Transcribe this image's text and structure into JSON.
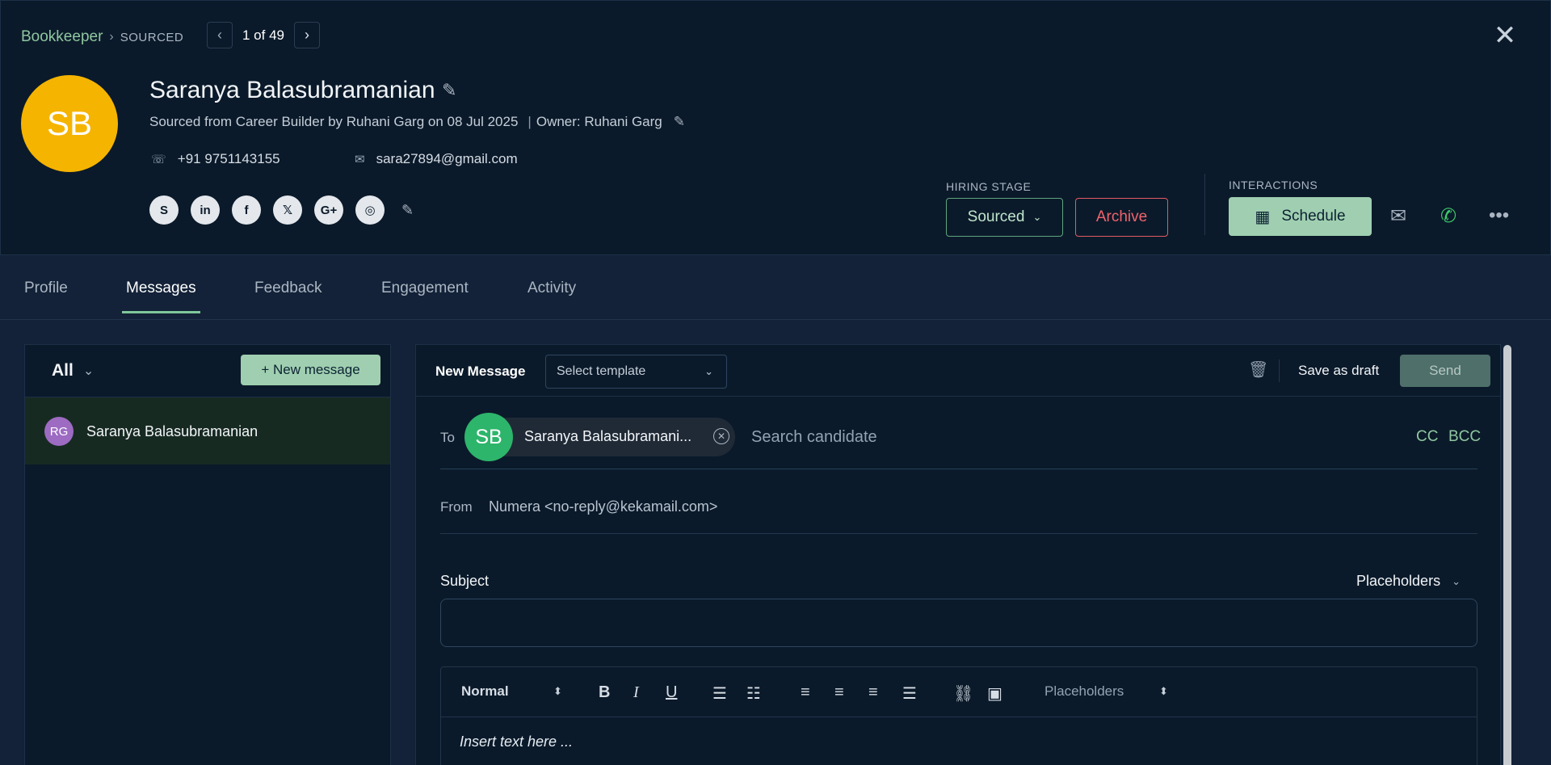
{
  "header": {
    "breadcrumb_job": "Bookkeeper",
    "breadcrumb_sep": "›",
    "breadcrumb_stage": "SOURCED",
    "pager_prev": "‹",
    "pager_next": "›",
    "pager_text": "1 of 49",
    "close_icon": "✕"
  },
  "candidate": {
    "initials": "SB",
    "name": "Saranya Balasubramanian",
    "sourced_text": "Sourced from Career Builder by Ruhani Garg on 08 Jul 2025",
    "owner_text": "Owner: Ruhani Garg",
    "phone": "+91 9751143155",
    "email": "sara27894@gmail.com",
    "avatar_color": "#f5b400",
    "socials": [
      {
        "icon": "skype-icon",
        "glyph": "S"
      },
      {
        "icon": "linkedin-icon",
        "glyph": "in"
      },
      {
        "icon": "facebook-icon",
        "glyph": "f"
      },
      {
        "icon": "x-twitter-icon",
        "glyph": "𝕏"
      },
      {
        "icon": "google-plus-icon",
        "glyph": "G+"
      },
      {
        "icon": "globe-icon",
        "glyph": "◎"
      }
    ]
  },
  "hiring_stage": {
    "label": "HIRING STAGE",
    "value": "Sourced",
    "archive_label": "Archive"
  },
  "interactions": {
    "label": "INTERACTIONS",
    "schedule_label": "Schedule",
    "icons": [
      "calendar-icon",
      "mail-icon",
      "whatsapp-icon",
      "more-icon"
    ]
  },
  "tabs": [
    {
      "label": "Profile"
    },
    {
      "label": "Messages",
      "active": true
    },
    {
      "label": "Feedback"
    },
    {
      "label": "Engagement"
    },
    {
      "label": "Activity"
    }
  ],
  "messages_list": {
    "filter_label": "All",
    "new_message_label": "+ New message",
    "threads": [
      {
        "initials": "RG",
        "name": "Saranya Balasubramanian",
        "avatar_color": "#9d6bc2"
      }
    ]
  },
  "composer": {
    "title": "New Message",
    "template_placeholder": "Select template",
    "save_draft_label": "Save as draft",
    "send_label": "Send",
    "to_label": "To",
    "recipient_initials": "SB",
    "recipient_name": "Saranya Balasubramani...",
    "search_placeholder": "Search candidate",
    "cc_label": "CC",
    "bcc_label": "BCC",
    "from_label": "From",
    "from_value": "Numera <no-reply@kekamail.com>",
    "subject_label": "Subject",
    "subject_placeholders_label": "Placeholders",
    "subject_value": "",
    "toolbar": {
      "text_style": "Normal",
      "placeholders_label": "Placeholders"
    },
    "body_placeholder": "Insert text here ..."
  },
  "colors": {
    "accent_green": "#9fcfb0",
    "archive_red": "#f0636d",
    "header_bg": "#0b1a2a",
    "page_bg": "#132238"
  }
}
